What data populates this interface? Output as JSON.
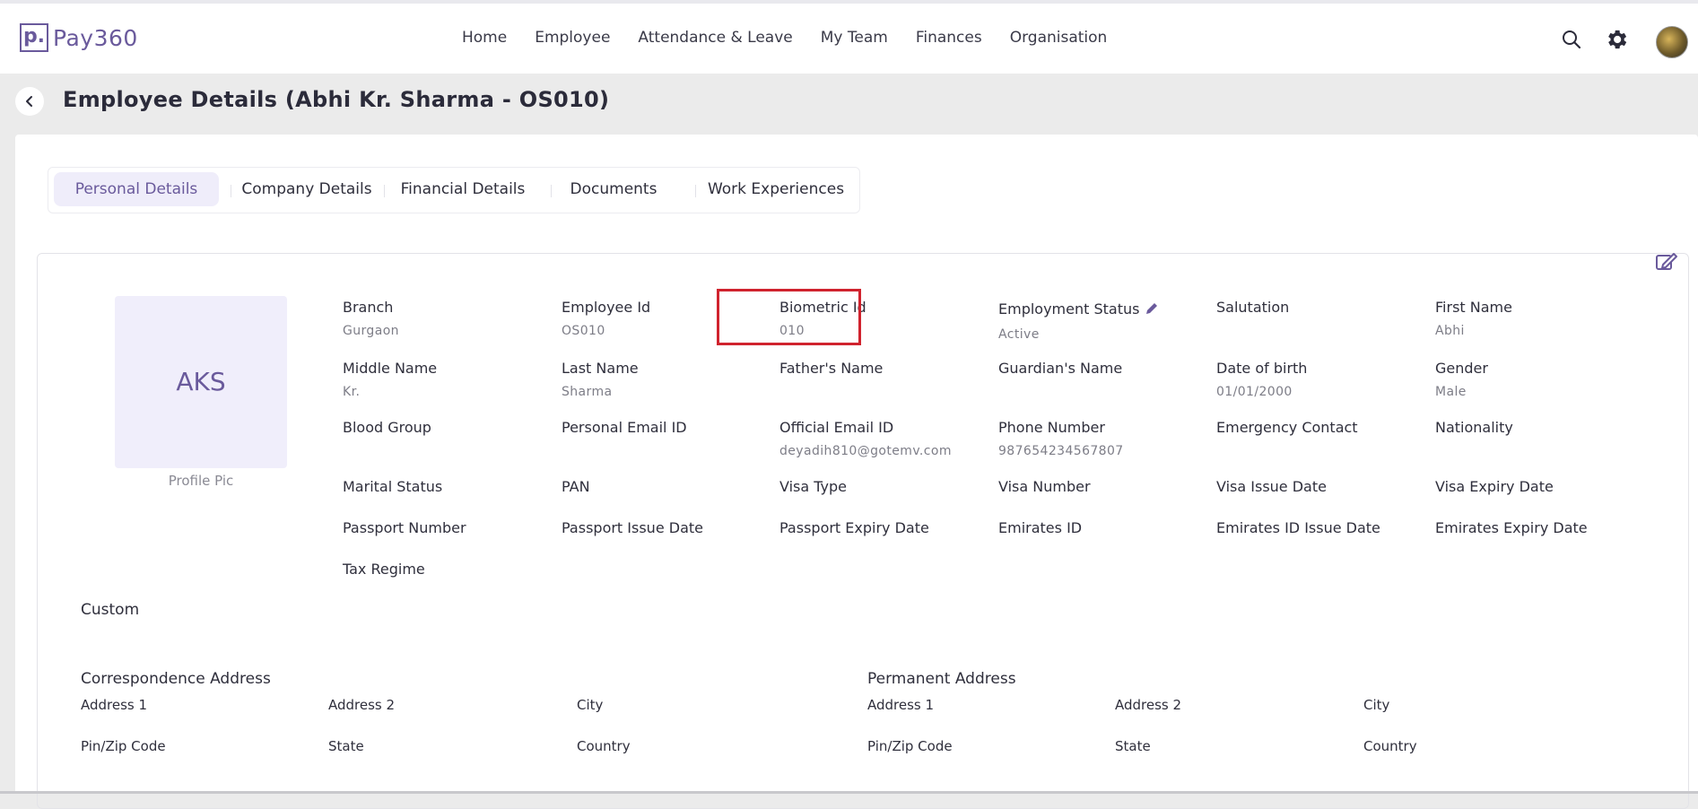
{
  "app": {
    "logo_mark": "p.",
    "logo_text": "Pay360"
  },
  "nav": {
    "items": [
      "Home",
      "Employee",
      "Attendance & Leave",
      "My Team",
      "Finances",
      "Organisation"
    ]
  },
  "header": {
    "title": "Employee Details (Abhi Kr. Sharma - OS010)"
  },
  "tabs": [
    {
      "label": "Personal Details",
      "active": true
    },
    {
      "label": "Company Details",
      "active": false
    },
    {
      "label": "Financial Details",
      "active": false
    },
    {
      "label": "Documents",
      "active": false
    },
    {
      "label": "Work Experiences",
      "active": false
    }
  ],
  "profile": {
    "initials": "AKS",
    "caption": "Profile Pic"
  },
  "fields": {
    "branch": {
      "label": "Branch",
      "value": "Gurgaon"
    },
    "employee_id": {
      "label": "Employee Id",
      "value": "OS010"
    },
    "biometric_id": {
      "label": "Biometric Id",
      "value": "010"
    },
    "employment_status": {
      "label": "Employment Status",
      "value": "Active"
    },
    "salutation": {
      "label": "Salutation",
      "value": ""
    },
    "first_name": {
      "label": "First Name",
      "value": "Abhi"
    },
    "middle_name": {
      "label": "Middle Name",
      "value": "Kr."
    },
    "last_name": {
      "label": "Last Name",
      "value": "Sharma"
    },
    "fathers_name": {
      "label": "Father's Name",
      "value": ""
    },
    "guardians_name": {
      "label": "Guardian's Name",
      "value": ""
    },
    "date_of_birth": {
      "label": "Date of birth",
      "value": "01/01/2000"
    },
    "gender": {
      "label": "Gender",
      "value": "Male"
    },
    "blood_group": {
      "label": "Blood Group",
      "value": ""
    },
    "personal_email": {
      "label": "Personal Email ID",
      "value": ""
    },
    "official_email": {
      "label": "Official Email ID",
      "value": "deyadih810@gotemv.com"
    },
    "phone_number": {
      "label": "Phone Number",
      "value": "987654234567807"
    },
    "emergency_contact": {
      "label": "Emergency Contact",
      "value": ""
    },
    "nationality": {
      "label": "Nationality",
      "value": ""
    },
    "marital_status": {
      "label": "Marital Status",
      "value": ""
    },
    "pan": {
      "label": "PAN",
      "value": ""
    },
    "visa_type": {
      "label": "Visa Type",
      "value": ""
    },
    "visa_number": {
      "label": "Visa Number",
      "value": ""
    },
    "visa_issue_date": {
      "label": "Visa Issue Date",
      "value": ""
    },
    "visa_expiry_date": {
      "label": "Visa Expiry Date",
      "value": ""
    },
    "passport_number": {
      "label": "Passport Number",
      "value": ""
    },
    "passport_issue_date": {
      "label": "Passport Issue Date",
      "value": ""
    },
    "passport_expiry_date": {
      "label": "Passport Expiry Date",
      "value": ""
    },
    "emirates_id": {
      "label": "Emirates ID",
      "value": ""
    },
    "emirates_id_issue_date": {
      "label": "Emirates ID Issue Date",
      "value": ""
    },
    "emirates_expiry_date": {
      "label": "Emirates Expiry Date",
      "value": ""
    },
    "tax_regime": {
      "label": "Tax Regime",
      "value": ""
    }
  },
  "custom": {
    "title": "Custom"
  },
  "correspondence_address": {
    "title": "Correspondence Address",
    "address1": "Address 1",
    "address2": "Address 2",
    "city": "City",
    "pin": "Pin/Zip Code",
    "state": "State",
    "country": "Country"
  },
  "permanent_address": {
    "title": "Permanent Address",
    "address1": "Address 1",
    "address2": "Address 2",
    "city": "City",
    "pin": "Pin/Zip Code",
    "state": "State",
    "country": "Country"
  },
  "colors": {
    "brand": "#6a5a9c",
    "active_tab_bg": "#efedfa",
    "highlight": "#d0232e"
  }
}
